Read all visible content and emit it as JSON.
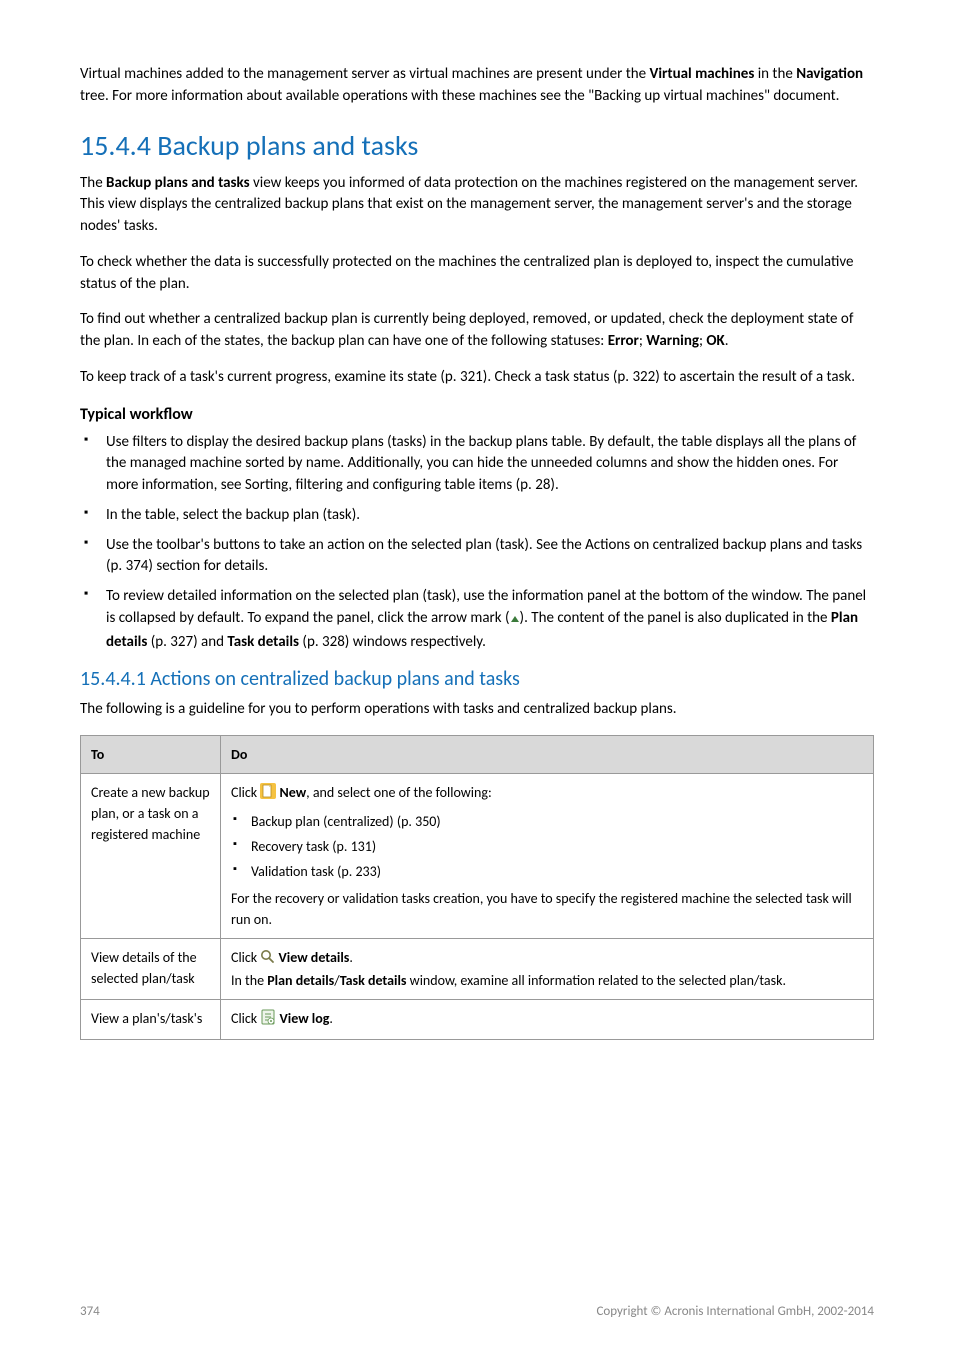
{
  "intro_para": {
    "pre": "Virtual machines added to the management server as virtual machines are present under the ",
    "bold1": "Virtual machines",
    "mid1": " in the ",
    "bold2": "Navigation",
    "post": " tree. For more information about available operations with these machines see the \"Backing up virtual machines\" document."
  },
  "h2_text": "15.4.4 Backup plans and tasks",
  "p1": {
    "pre": "The ",
    "bold": "Backup plans and tasks",
    "post": " view keeps you informed of data protection on the machines registered on the management server. This view displays the centralized backup plans that exist on the management server, the management server's and the storage nodes' tasks."
  },
  "p2": "To check whether the data is successfully protected on the machines the centralized plan is deployed to, inspect the cumulative status of the plan.",
  "p3": {
    "pre": "To find out whether a centralized backup plan is currently being deployed, removed, or updated, check the deployment state of the plan. In each of the states, the backup plan can have one of the following statuses: ",
    "b1": "Error",
    "sep1": "; ",
    "b2": "Warning",
    "sep2": "; ",
    "b3": "OK",
    "end": "."
  },
  "p4": "To keep track of a task's current progress, examine its state (p. 321). Check a task status (p. 322) to ascertain the result of a task.",
  "h4_workflow": "Typical workflow",
  "bullets": [
    "Use filters to display the desired backup plans (tasks) in the backup plans table. By default, the table displays all the plans of the managed machine sorted by name. Additionally, you can hide the unneeded columns and show the hidden ones. For more information, see Sorting, filtering and configuring table items (p. 28).",
    "In the table, select the backup plan (task).",
    "Use the toolbar's buttons to take an action on the selected plan (task). See the Actions on centralized backup plans and tasks (p. 374) section for details."
  ],
  "bullet4": {
    "pre": "To review detailed information on the selected plan (task), use the information panel at the bottom of the window. The panel is collapsed by default. To expand the panel, click the arrow mark (",
    "mid": "). The content of the panel is also duplicated in the ",
    "b1": "Plan details",
    "mid2": " (p. 327) and ",
    "b2": "Task details",
    "post": " (p. 328) windows respectively."
  },
  "h3_text": "15.4.4.1 Actions on centralized backup plans and tasks",
  "p5": "The following is a guideline for you to perform operations with tasks and centralized backup plans.",
  "table": {
    "head": {
      "to": "To",
      "do": "Do"
    },
    "row1": {
      "to": "Create a new backup plan, or a task on a registered machine",
      "click": "Click ",
      "new_label": "New",
      "after_new": ", and select one of the following:",
      "items": [
        "Backup plan (centralized) (p. 350)",
        "Recovery task (p. 131)",
        "Validation task (p. 233)"
      ],
      "note": "For the recovery or validation tasks creation, you have to specify the registered machine the selected task will run on."
    },
    "row2": {
      "to": "View details of the selected plan/task",
      "click": "Click ",
      "label": "View details",
      "line2_pre": "In the ",
      "bold1": "Plan details",
      "sep": "/",
      "bold2": "Task details",
      "line2_post": " window, examine all information related to the selected plan/task."
    },
    "row3": {
      "to": "View a plan's/task's",
      "click": "Click ",
      "label": "View log"
    }
  },
  "footer": {
    "page": "374",
    "copyright": "Copyright © Acronis International GmbH, 2002-2014"
  }
}
